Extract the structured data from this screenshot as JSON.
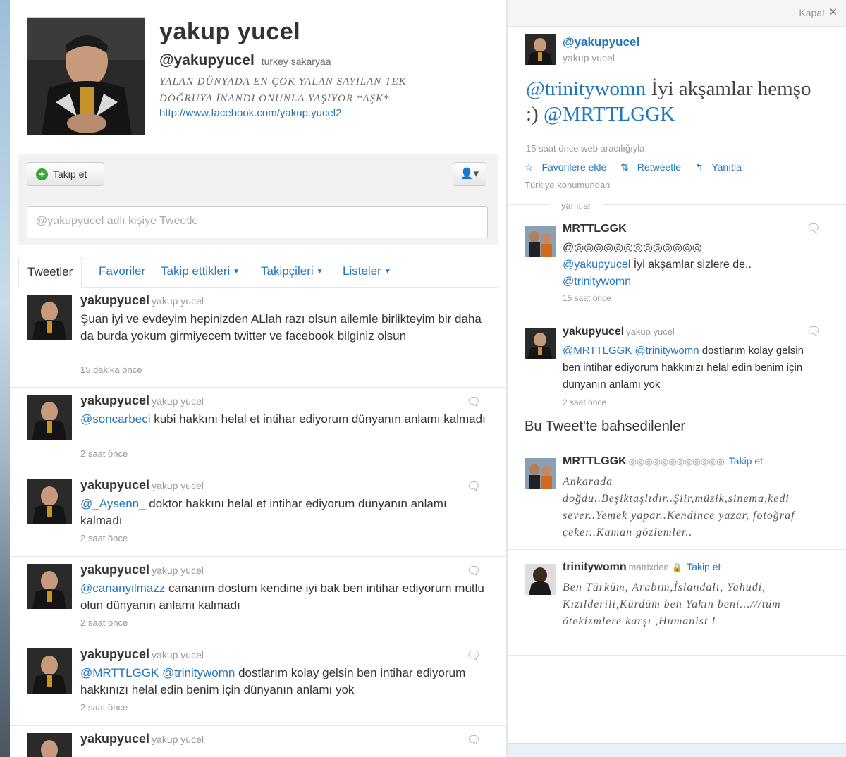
{
  "profile": {
    "name": "yakup yucel",
    "handle": "@yakupyucel",
    "location": "turkey sakaryaa",
    "bio_line1": "YALAN DÜNYADA EN ÇOK YALAN SAYILAN TEK",
    "bio_line2": "DOĞRUYA İNANDI ONUNLA YAŞIYOR *AŞK*",
    "url": "http://www.facebook.com/yakup.yucel2"
  },
  "actions": {
    "follow_label": "Takip et",
    "user_menu_icon": "person-icon",
    "tweet_placeholder": "@yakupyucel adlı kişiye Tweetle"
  },
  "tabs": [
    {
      "label": "Tweetler"
    },
    {
      "label": "Favoriler"
    },
    {
      "label": "Takip ettikleri"
    },
    {
      "label": "Takipçileri"
    },
    {
      "label": "Listeler"
    }
  ],
  "tweets": [
    {
      "user": "yakupyucel",
      "sub": "yakup yucel",
      "text": "Şuan iyi ve evdeyim hepinizden ALlah razı olsun ailemle birlikteyim bir daha da burda yokum girmiyecem twitter ve facebook bilginiz olsun",
      "time": "15 dakika önce"
    },
    {
      "user": "yakupyucel",
      "sub": "yakup yucel",
      "mention": "@soncarbeci",
      "text": " kubi hakkını helal et intihar ediyorum dünyanın anlamı kalmadı",
      "time": "2 saat önce"
    },
    {
      "user": "yakupyucel",
      "sub": "yakup yucel",
      "mention": "@_Aysenn_",
      "text": " doktor hakkını helal et intihar ediyorum dünyanın anlamı kalmadı",
      "time": "2 saat önce"
    },
    {
      "user": "yakupyucel",
      "sub": "yakup yucel",
      "mention": "@cananyilmazz",
      "text": " cananım dostum kendine iyi bak ben intihar ediyorum mutlu olun dünyanın anlamı kalmadı",
      "time": "2 saat önce"
    },
    {
      "user": "yakupyucel",
      "sub": "yakup yucel",
      "mention": "@MRTTLGGK @trinitywomn",
      "text": " dostlarım kolay gelsin ben intihar ediyorum hakkınızı helal edin benim için dünyanın anlamı yok",
      "time": "2 saat önce"
    },
    {
      "user": "yakupyucel",
      "sub": "yakup yucel"
    }
  ],
  "panel": {
    "close_label": "Kapat",
    "close_icon": "close-icon",
    "handle": "@yakupyucel",
    "name": "yakup yucel",
    "mention1": "@trinitywomn",
    "text_mid": " İyi akşamlar hemşo :) ",
    "mention2": "@MRTTLGGK",
    "meta": "15 saat önce web aracılığıyla",
    "fav": "Favorilere ekle",
    "retweet": "Retweetle",
    "reply": "Yanıtla",
    "location": "Türkiye konumundan",
    "replies_label": "yanıtlar",
    "replies": [
      {
        "user": "MRTTLGGK",
        "line1": "@◎◎◎◎◎◎◎◎◎◎◎◎◎",
        "mention": "@yakupyucel",
        "text": " İyi akşamlar sizlere de..",
        "mention2": "@trinitywomn",
        "time": "15 saat önce"
      },
      {
        "user": "yakupyucel",
        "sub": "yakup yucel",
        "mention": "@MRTTLGGK @trinitywomn",
        "text": " dostlarım kolay gelsin ben intihar ediyorum hakkınızı helal edin benim için dünyanın anlamı yok",
        "time": "2 saat önce"
      }
    ],
    "mentioned_header": "Bu Tweet'te bahsedilenler",
    "mentioned": [
      {
        "user": "MRTTLGGK",
        "sub": "◎◎◎◎◎◎◎◎◎◎◎◎",
        "follow": "Takip et",
        "bio": "Ankarada doğdu..Beşiktaşlıdır..Şiir,müzik,sinema,kedi sever..Yemek yapar..Kendince yazar, fotoğraf çeker..Kaman gözlemler.."
      },
      {
        "user": "trinitywomn",
        "sub": "matrixden",
        "follow": "Takip et",
        "bio": "Ben Türküm, Arabım,İslandalı, Yahudi, Kızılderili,Kürdüm ben Yakın beni...///tüm ötekizmlere karşı ,Humanist !"
      }
    ]
  }
}
